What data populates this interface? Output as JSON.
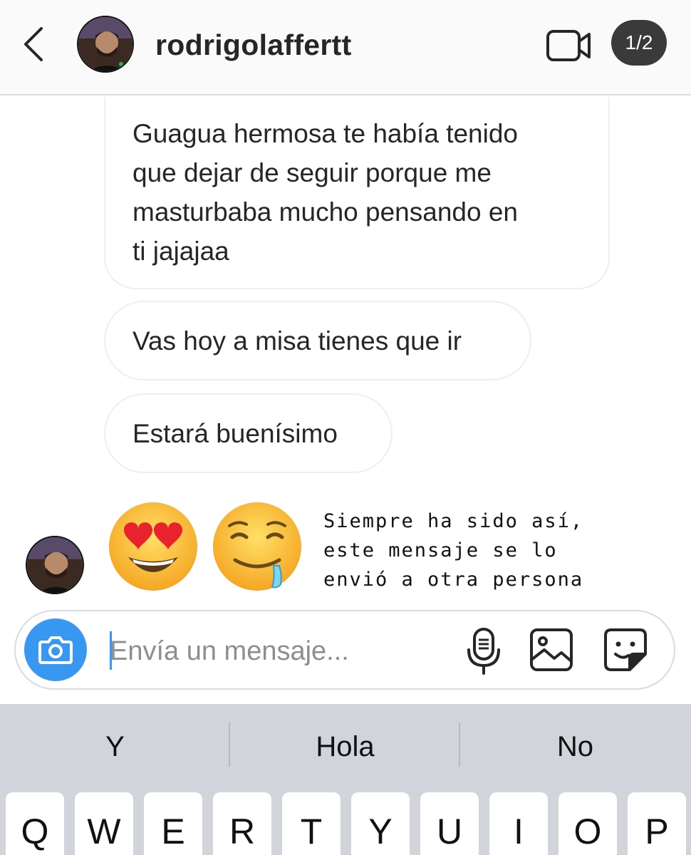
{
  "header": {
    "username": "rodrigolaffertt",
    "page_indicator": "1/2"
  },
  "messages": [
    {
      "text": "Guagua hermosa te había tenido que dejar de seguir porque me masturbaba mucho pensando en ti jajajaa",
      "lines": [
        "Guagua hermosa te había tenido",
        "que dejar de seguir porque me",
        "masturbaba mucho pensando en",
        "ti jajajaa"
      ]
    },
    {
      "text": "Vas hoy a misa tienes que ir"
    },
    {
      "text": "Estará buenísimo"
    }
  ],
  "emojis": [
    "heart-eyes-emoji",
    "drooling-face-emoji"
  ],
  "annotation": {
    "lines": [
      "Siempre ha sido así,",
      "este mensaje se lo",
      "envió a otra persona"
    ]
  },
  "composer": {
    "placeholder": "Envía un mensaje..."
  },
  "keyboard": {
    "suggestions": [
      "Y",
      "Hola",
      "No"
    ],
    "keys": [
      "Q",
      "W",
      "E",
      "R",
      "T",
      "Y",
      "U",
      "I",
      "O",
      "P"
    ]
  },
  "colors": {
    "accent": "#3897f0",
    "bubble_border": "#efefef",
    "keyboard_bg": "#d1d4db"
  },
  "icons": [
    "chevron-left-icon",
    "video-camera-icon",
    "camera-icon",
    "microphone-icon",
    "gallery-icon",
    "sticker-icon"
  ]
}
